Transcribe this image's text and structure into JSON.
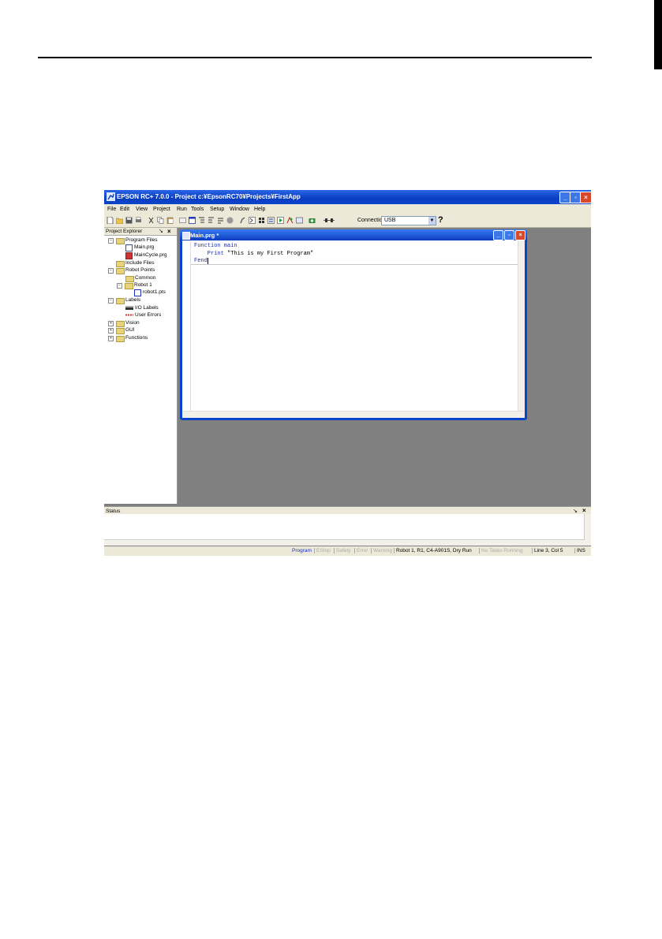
{
  "window": {
    "title": "EPSON RC+ 7.0.0 - Project c:¥EpsonRC70¥Projects¥FirstApp"
  },
  "menu": [
    "File",
    "Edit",
    "View",
    "Project",
    "Run",
    "Tools",
    "Setup",
    "Window",
    "Help"
  ],
  "toolbar": {
    "connection_label": "Connection:",
    "connection_value": "USB",
    "help_glyph": "?"
  },
  "project_explorer": {
    "title": "Project Explorer",
    "pin": "↘",
    "close": "×",
    "items": [
      {
        "label": "Program Files",
        "expander": "−",
        "icon": "folder-icon"
      },
      {
        "label": "Main.prg",
        "icon": "program-file-icon"
      },
      {
        "label": "MainCycle.prg",
        "icon": "program-file-icon"
      },
      {
        "label": "Include Files",
        "icon": "folder-icon"
      },
      {
        "label": "Robot Points",
        "expander": "−",
        "icon": "folder-icon"
      },
      {
        "label": "Common",
        "icon": "folder-icon"
      },
      {
        "label": "Robot 1",
        "expander": "−",
        "icon": "folder-icon"
      },
      {
        "label": "robot1.pts",
        "icon": "points-file-icon"
      },
      {
        "label": "Labels",
        "expander": "−",
        "icon": "folder-icon"
      },
      {
        "label": "I/O Labels",
        "icon": "io-labels-icon"
      },
      {
        "label": "User Errors",
        "icon": "user-errors-icon"
      },
      {
        "label": "Vision",
        "expander": "+",
        "icon": "folder-icon"
      },
      {
        "label": "GUI",
        "expander": "+",
        "icon": "folder-icon"
      },
      {
        "label": "Functions",
        "expander": "+",
        "icon": "folder-icon"
      }
    ]
  },
  "editor": {
    "title": "Main.prg *",
    "lines": [
      {
        "kw": "Function main",
        "rest": ""
      },
      {
        "kw": "    Print",
        "rest": " \"This is my First Program\""
      },
      {
        "kw": "Fend",
        "rest": ""
      }
    ]
  },
  "status_panel": {
    "title": "Status"
  },
  "statusbar": {
    "mode": "Program",
    "estop": "EStop",
    "safety": "Safety",
    "error": "Error",
    "warning": "Warning",
    "robot": "Robot 1, R1, C4-A901S, Dry Run",
    "tasks": "No Tasks Running",
    "position": "Line 3, Col 5",
    "insert": "INS"
  }
}
